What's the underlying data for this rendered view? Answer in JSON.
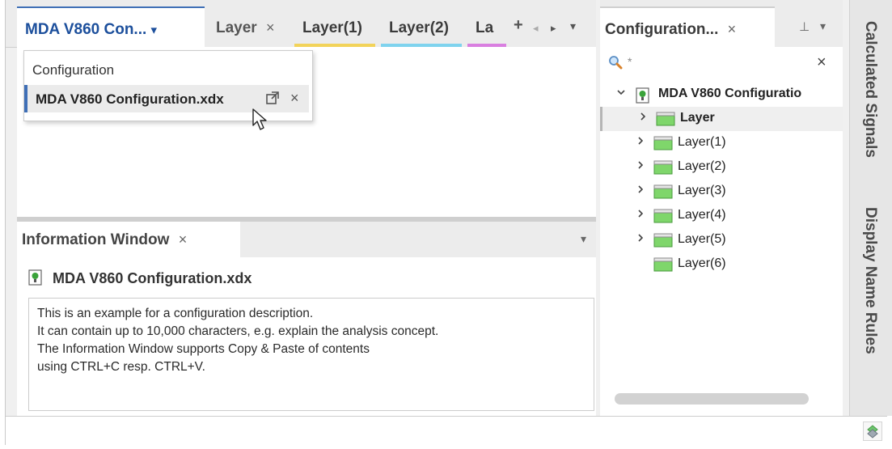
{
  "doc_tabs": {
    "active_label": "MDA V860 Con...",
    "active_dropdown_glyph": "▾",
    "tabs": [
      {
        "label": "Layer",
        "close": "×",
        "color": "#ffffff"
      },
      {
        "label": "Layer(1)",
        "color": "#f2d35a"
      },
      {
        "label": "Layer(2)",
        "color": "#7fd3ee"
      },
      {
        "label": "La",
        "color": "#d97fe0"
      }
    ],
    "add_glyph": "+",
    "left_glyph": "◂",
    "right_glyph": "▸",
    "menu_glyph": "▾"
  },
  "dropdown": {
    "header": "Configuration",
    "item_label": "MDA V860 Configuration.xdx",
    "item_icon": "open-external-icon",
    "item_close": "×"
  },
  "info_window": {
    "tab_label": "Information Window",
    "tab_close": "×",
    "menu_glyph": "▾",
    "title": "MDA V860 Configuration.xdx",
    "lines": [
      "This is an example for a configuration description.",
      "It can contain up to 10,000 characters, e.g. explain the analysis concept.",
      "The Information Window supports Copy & Paste of contents",
      "using CTRL+C resp. CTRL+V."
    ]
  },
  "right_panel": {
    "tab_label": "Configuration...",
    "tab_close": "×",
    "pin_glyph": "⊥",
    "menu_glyph": "▾",
    "search_value": "*",
    "search_clear": "×",
    "root_label": "MDA V860 Configuratio",
    "items": [
      "Layer",
      "Layer(1)",
      "Layer(2)",
      "Layer(3)",
      "Layer(4)",
      "Layer(5)",
      "Layer(6)"
    ],
    "expand_glyph": "›",
    "collapse_glyph": "⌄"
  },
  "side_tabs": {
    "calculated_signals": "Calculated Signals",
    "display_name_rules": "Display Name Rules"
  },
  "colors": {
    "accent": "#3f6fb6",
    "folder_green": "#7fd66b"
  }
}
